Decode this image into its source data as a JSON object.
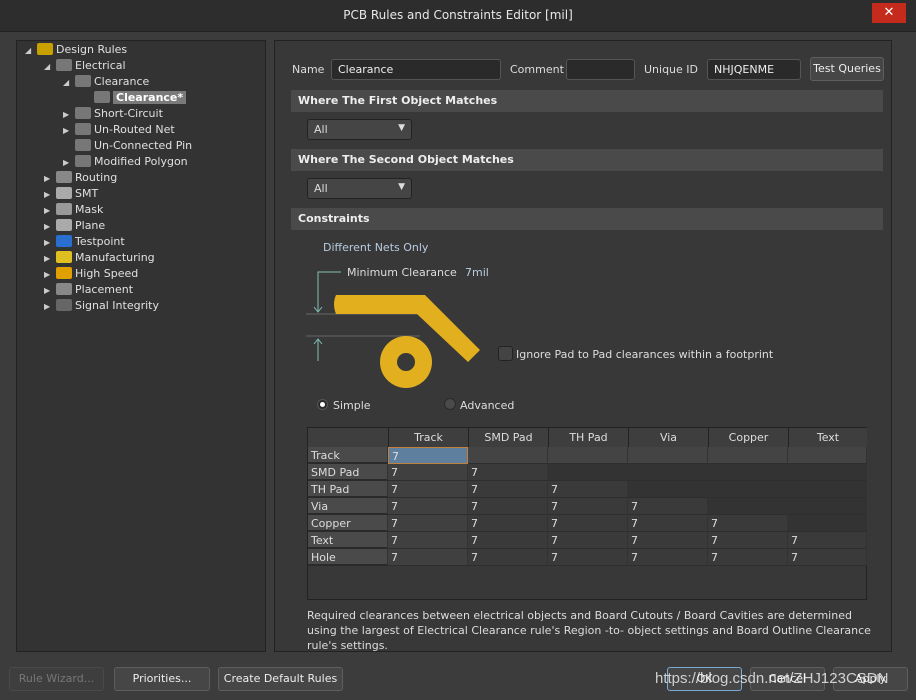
{
  "window": {
    "title": "PCB Rules and Constraints Editor [mil]",
    "close_icon": "close-icon"
  },
  "tree": [
    {
      "label": "Design Rules",
      "level": 0,
      "expander": "open",
      "icon": "design-rules-folder-icon",
      "color": "#c8a000"
    },
    {
      "label": "Electrical",
      "level": 1,
      "expander": "open",
      "icon": "electrical-rule-icon",
      "color": "#777"
    },
    {
      "label": "Clearance",
      "level": 2,
      "expander": "open",
      "icon": "clearance-rule-icon",
      "color": "#777"
    },
    {
      "label": "Clearance*",
      "level": 3,
      "expander": "none",
      "icon": "clearance-rule-icon",
      "color": "#777",
      "selected": true
    },
    {
      "label": "Short-Circuit",
      "level": 2,
      "expander": "closed",
      "icon": "short-circuit-rule-icon",
      "color": "#777"
    },
    {
      "label": "Un-Routed Net",
      "level": 2,
      "expander": "closed",
      "icon": "unrouted-net-rule-icon",
      "color": "#777"
    },
    {
      "label": "Un-Connected Pin",
      "level": 2,
      "expander": "none",
      "icon": "unconnected-pin-rule-icon",
      "color": "#777"
    },
    {
      "label": "Modified Polygon",
      "level": 2,
      "expander": "closed",
      "icon": "modified-polygon-rule-icon",
      "color": "#777"
    },
    {
      "label": "Routing",
      "level": 1,
      "expander": "closed",
      "icon": "routing-icon",
      "color": "#888"
    },
    {
      "label": "SMT",
      "level": 1,
      "expander": "closed",
      "icon": "smt-icon",
      "color": "#aaa"
    },
    {
      "label": "Mask",
      "level": 1,
      "expander": "closed",
      "icon": "mask-icon",
      "color": "#999"
    },
    {
      "label": "Plane",
      "level": 1,
      "expander": "closed",
      "icon": "plane-icon",
      "color": "#aaa"
    },
    {
      "label": "Testpoint",
      "level": 1,
      "expander": "closed",
      "icon": "testpoint-icon",
      "color": "#2a6fd0"
    },
    {
      "label": "Manufacturing",
      "level": 1,
      "expander": "closed",
      "icon": "manufacturing-icon",
      "color": "#e0c020"
    },
    {
      "label": "High Speed",
      "level": 1,
      "expander": "closed",
      "icon": "high-speed-icon",
      "color": "#e0a000"
    },
    {
      "label": "Placement",
      "level": 1,
      "expander": "closed",
      "icon": "placement-icon",
      "color": "#888"
    },
    {
      "label": "Signal Integrity",
      "level": 1,
      "expander": "closed",
      "icon": "signal-integrity-icon",
      "color": "#666"
    }
  ],
  "rule": {
    "name_label": "Name",
    "name_value": "Clearance",
    "comment_label": "Comment",
    "comment_value": "",
    "uid_label": "Unique ID",
    "uid_value": "NHJQENME",
    "test_queries": "Test Queries"
  },
  "first": {
    "header": "Where The First Object Matches",
    "value": "All"
  },
  "second": {
    "header": "Where The Second Object Matches",
    "value": "All"
  },
  "constraints": {
    "header": "Constraints",
    "net_scope": "Different Nets Only",
    "min_clearance_label": "Minimum Clearance",
    "min_clearance_value": "7mil",
    "ignore_pad_label": "Ignore Pad to Pad clearances within a footprint",
    "ignore_pad_checked": false,
    "mode_simple": "Simple",
    "mode_advanced": "Advanced",
    "mode_selected": "Simple",
    "trace_color": "#e2b01e"
  },
  "matrix": {
    "columns": [
      "Track",
      "SMD Pad",
      "TH Pad",
      "Via",
      "Copper",
      "Text"
    ],
    "rows": [
      {
        "label": "Track",
        "values": [
          "7"
        ]
      },
      {
        "label": "SMD Pad",
        "values": [
          "7",
          "7"
        ]
      },
      {
        "label": "TH Pad",
        "values": [
          "7",
          "7",
          "7"
        ]
      },
      {
        "label": "Via",
        "values": [
          "7",
          "7",
          "7",
          "7"
        ]
      },
      {
        "label": "Copper",
        "values": [
          "7",
          "7",
          "7",
          "7",
          "7"
        ]
      },
      {
        "label": "Text",
        "values": [
          "7",
          "7",
          "7",
          "7",
          "7",
          "7"
        ]
      },
      {
        "label": "Hole",
        "values": [
          "7",
          "7",
          "7",
          "7",
          "7",
          "7"
        ]
      }
    ]
  },
  "footnote": "Required clearances between electrical objects and Board Cutouts / Board Cavities are determined using the largest of Electrical Clearance rule's Region -to- object settings and Board Outline Clearance rule's settings.",
  "buttons": {
    "rule_wizard": "Rule Wizard...",
    "priorities": "Priorities...",
    "create_default": "Create Default Rules",
    "ok": "OK",
    "cancel": "Cancel",
    "apply": "Apply"
  },
  "watermark": "https://blog.csdn.net/ZHJ123CSDN"
}
